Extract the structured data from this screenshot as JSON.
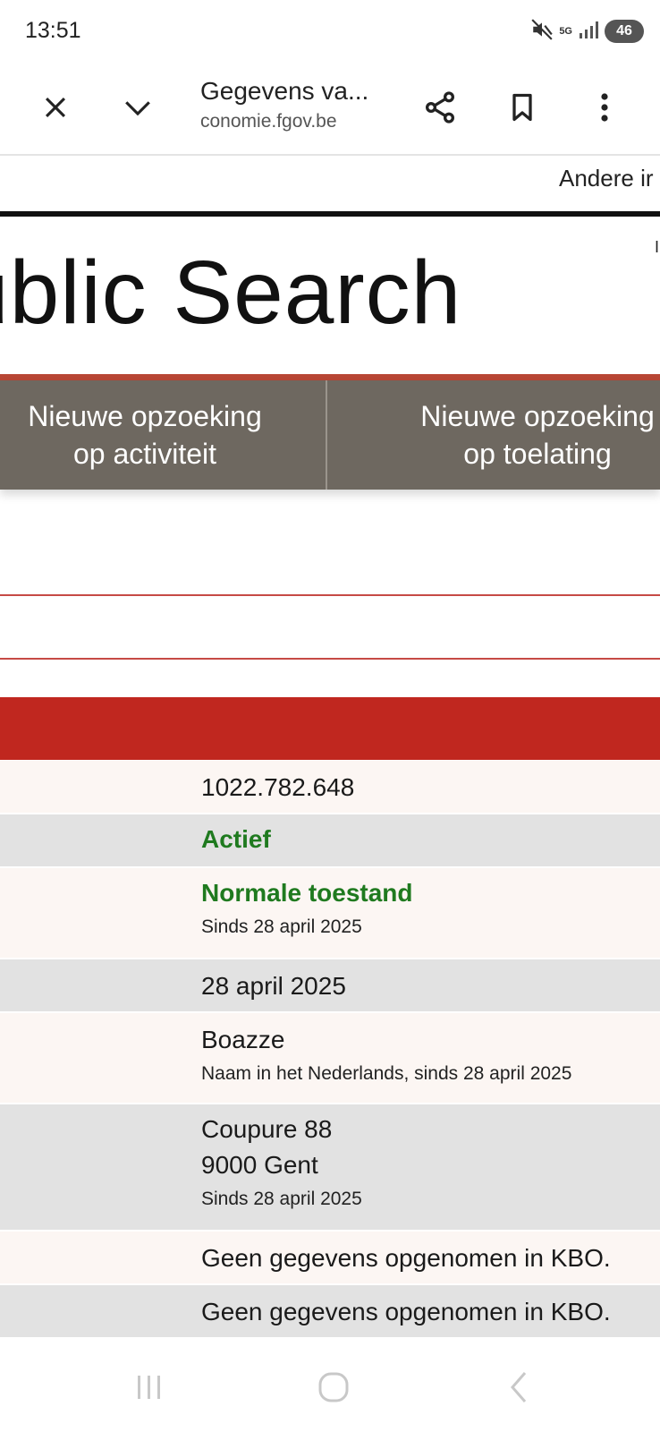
{
  "status_bar": {
    "time": "13:51",
    "network": "5G",
    "battery": "46",
    "icons": [
      "mute-icon",
      "signal-icon"
    ]
  },
  "toolbar": {
    "title": "Gegevens va...",
    "url": "conomie.fgov.be",
    "icons": [
      "close-icon",
      "chevron-down-icon",
      "share-icon",
      "bookmark-icon",
      "more-vert-icon"
    ]
  },
  "page": {
    "top_link": "Andere ir",
    "logo_text": "ublic Search",
    "logo_right_mark": "I",
    "nav": {
      "item1_line1": "Nieuwe opzoeking",
      "item1_line2": "op activiteit",
      "item2_line1": "Nieuwe opzoeking",
      "item2_line2": "op toelating"
    },
    "colors": {
      "red_band": "#c0271f",
      "nav_bg": "#6e6860",
      "status_green": "#1f7a1f"
    },
    "rows": [
      {
        "main": "1022.782.648"
      },
      {
        "main": "Actief"
      },
      {
        "main": "Normale toestand",
        "sub": "Sinds 28 april 2025"
      },
      {
        "main": "28 april 2025"
      },
      {
        "main": "Boazze",
        "sub": "Naam in het Nederlands, sinds 28 april 2025"
      },
      {
        "main": "Coupure 88",
        "main2": "9000 Gent",
        "sub": "Sinds 28 april 2025"
      },
      {
        "main": "Geen gegevens opgenomen in KBO."
      },
      {
        "main": "Geen gegevens opgenomen in KBO."
      }
    ]
  },
  "nav_bar": {
    "icons": [
      "recent-apps-icon",
      "home-icon",
      "back-icon"
    ]
  }
}
